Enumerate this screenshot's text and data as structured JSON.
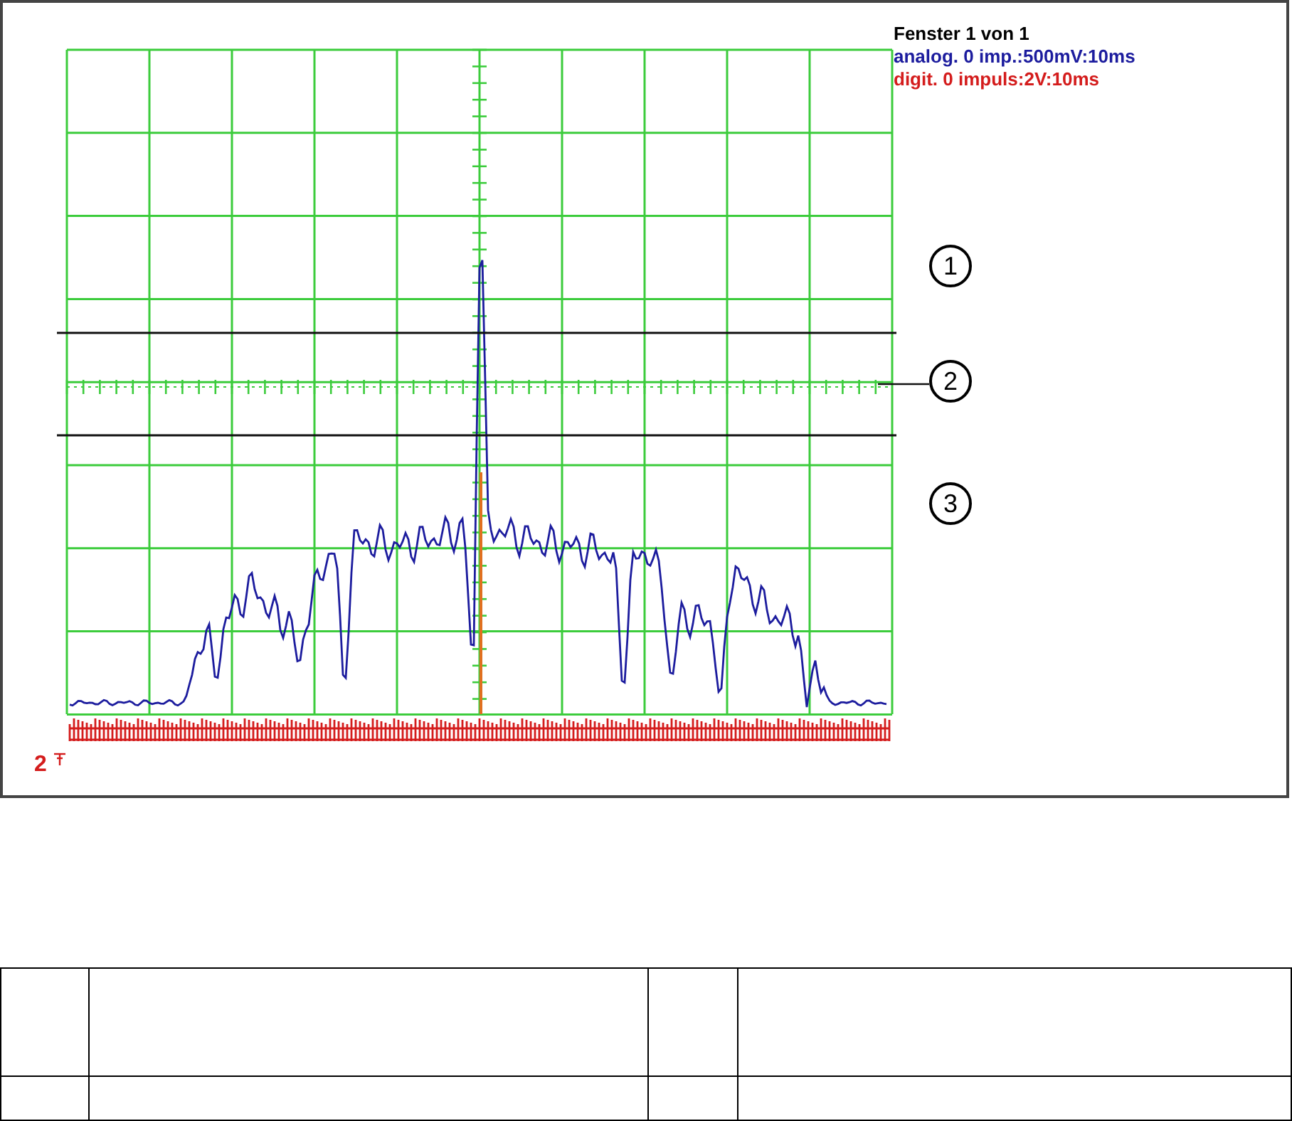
{
  "window": {
    "title": "Fenster 1 von 1"
  },
  "channels": [
    {
      "label": "analog. 0 imp.:500mV:10ms",
      "color": "#1c1c9e"
    },
    {
      "label": "digit. 0 impuls:2V:10ms",
      "color": "#d41c1c"
    }
  ],
  "trigger": {
    "label": "2"
  },
  "callouts": [
    {
      "label": "1"
    },
    {
      "label": "2"
    },
    {
      "label": "3"
    }
  ]
}
